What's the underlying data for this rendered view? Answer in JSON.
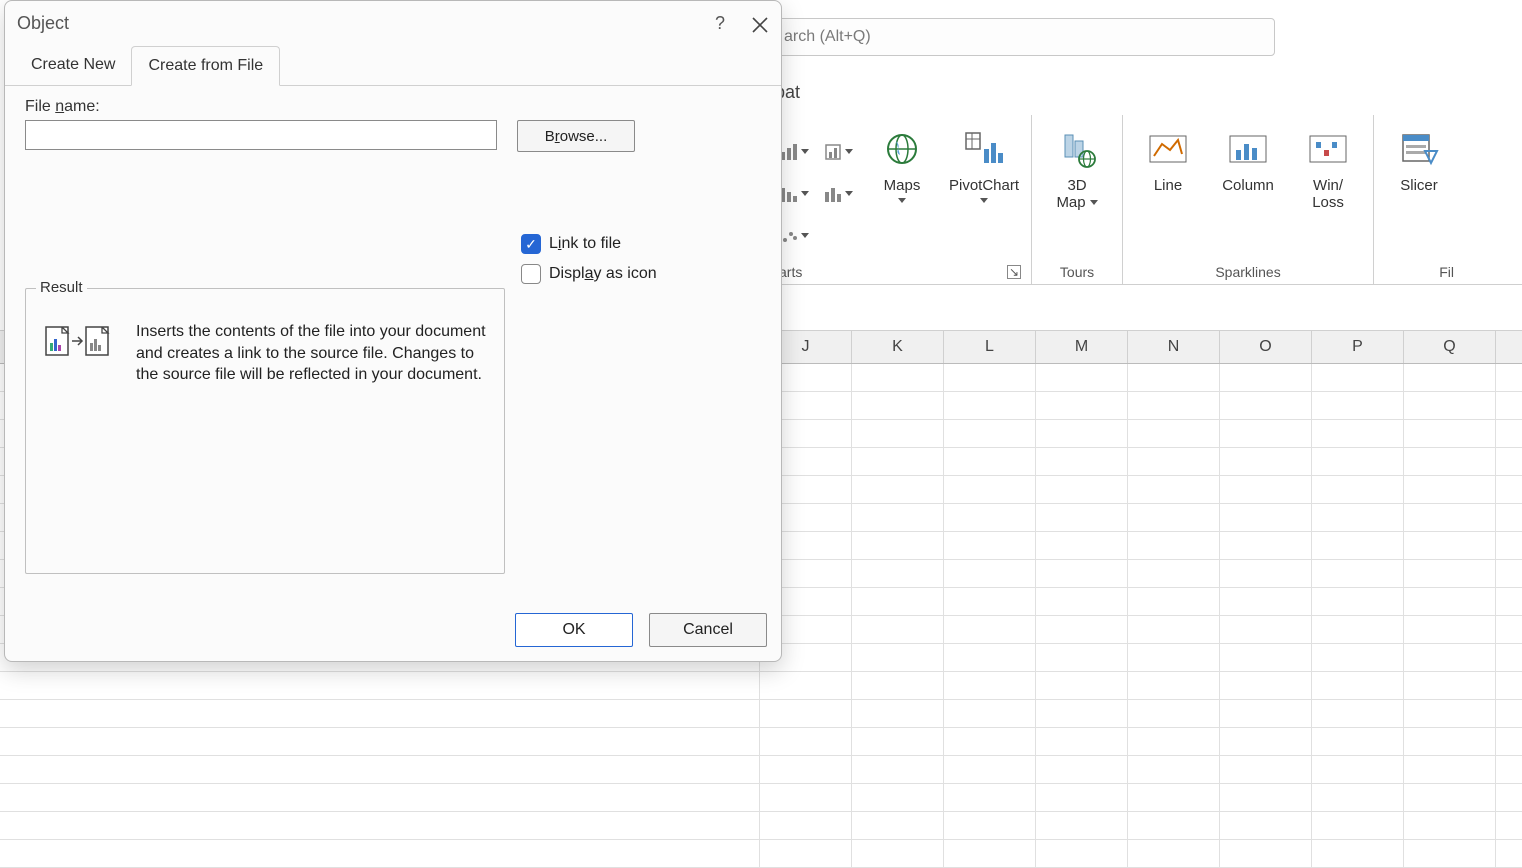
{
  "background": {
    "search_placeholder": "arch (Alt+Q)",
    "ribbon_tab_fragment": "bat",
    "groups": {
      "charts": {
        "label_fragment": "arts"
      },
      "tours": {
        "label": "Tours"
      },
      "sparklines": {
        "label": "Sparklines"
      },
      "filters": {
        "label_fragment": "Fil"
      }
    },
    "buttons": {
      "maps": "Maps",
      "pivotchart": "PivotChart",
      "map3d_line1": "3D",
      "map3d_line2": "Map",
      "line": "Line",
      "column": "Column",
      "winloss_line1": "Win/",
      "winloss_line2": "Loss",
      "slicer": "Slicer"
    },
    "columns": [
      "J",
      "K",
      "L",
      "M",
      "N",
      "O",
      "P",
      "Q"
    ]
  },
  "dialog": {
    "title": "Object",
    "help_char": "?",
    "tabs": {
      "create_new": "Create New",
      "create_from_file": "Create from File"
    },
    "file_label_pre": "File ",
    "file_label_u": "n",
    "file_label_post": "ame:",
    "file_value": "",
    "browse_pre": "B",
    "browse_u": "r",
    "browse_post": "owse...",
    "link_pre": "L",
    "link_u": "i",
    "link_post": "nk to file",
    "link_checked": true,
    "display_pre": "Displ",
    "display_u": "a",
    "display_post": "y as icon",
    "display_checked": false,
    "result_legend": "Result",
    "result_text": "Inserts the contents of the file into your document and creates a link to the source file. Changes to the source file will be reflected in your document.",
    "ok": "OK",
    "cancel": "Cancel"
  }
}
